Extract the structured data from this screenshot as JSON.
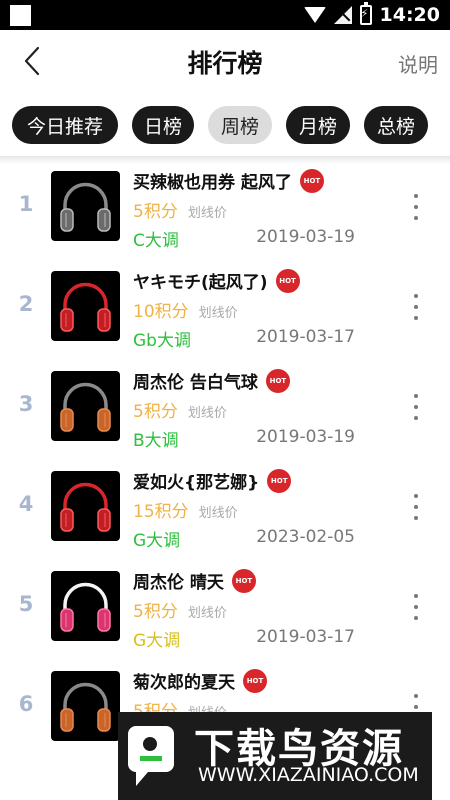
{
  "status_bar": {
    "time": "14:20"
  },
  "header": {
    "title": "排行榜",
    "help_label": "说明"
  },
  "tabs": [
    {
      "label": "今日推荐",
      "active": false
    },
    {
      "label": "日榜",
      "active": false
    },
    {
      "label": "周榜",
      "active": true
    },
    {
      "label": "月榜",
      "active": false
    },
    {
      "label": "总榜",
      "active": false
    }
  ],
  "items": [
    {
      "rank": "1",
      "title": "买辣椒也用券 起风了",
      "hot": "HOT",
      "price": "5积分",
      "strike": "划线价",
      "key": "C大调",
      "key_color": "#2fbf3f",
      "date": "2019-03-19",
      "cover": "headphones-gray"
    },
    {
      "rank": "2",
      "title": "ヤキモチ(起风了)",
      "hot": "HOT",
      "price": "10积分",
      "strike": "划线价",
      "key": "Gb大调",
      "key_color": "#2fbf3f",
      "date": "2019-03-17",
      "cover": "headphones-red"
    },
    {
      "rank": "3",
      "title": "周杰伦 告白气球",
      "hot": "HOT",
      "price": "5积分",
      "strike": "划线价",
      "key": "B大调",
      "key_color": "#2fbf3f",
      "date": "2019-03-19",
      "cover": "headphones-orange"
    },
    {
      "rank": "4",
      "title": "爱如火{那艺娜}",
      "hot": "HOT",
      "price": "15积分",
      "strike": "划线价",
      "key": "G大调",
      "key_color": "#2fbf3f",
      "date": "2023-02-05",
      "cover": "headphones-red"
    },
    {
      "rank": "5",
      "title": "周杰伦 晴天",
      "hot": "HOT",
      "price": "5积分",
      "strike": "划线价",
      "key": "G大调",
      "key_color": "#d6c21a",
      "date": "2019-03-17",
      "cover": "headphones-pink"
    },
    {
      "rank": "6",
      "title": "菊次郎的夏天",
      "hot": "HOT",
      "price": "5积分",
      "strike": "划线价",
      "key": "",
      "key_color": "#2fbf3f",
      "date": "",
      "cover": "headphones-orange"
    }
  ],
  "watermark": {
    "title": "下载鸟资源",
    "url": "WWW.XIAZAINIAO.COM"
  },
  "colors": {
    "price": "#f0b244",
    "rank": "#a9b6cf",
    "hot": "#d8262b"
  }
}
